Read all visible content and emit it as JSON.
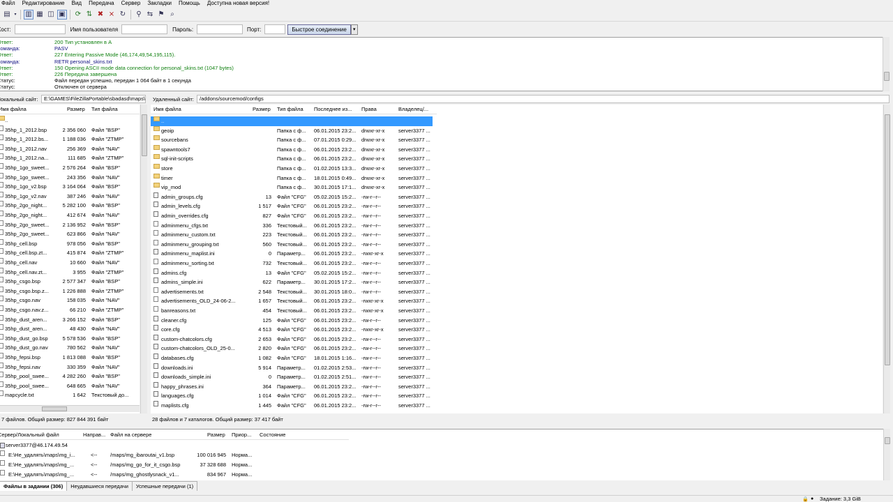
{
  "menu": [
    "Файл",
    "Редактирование",
    "Вид",
    "Передача",
    "Сервер",
    "Закладки",
    "Помощь",
    "Доступна новая версия!"
  ],
  "quickconnect": {
    "host_label": "Хост:",
    "user_label": "Имя пользователя",
    "pass_label": "Пароль:",
    "port_label": "Порт:",
    "button": "Быстрое соединение",
    "host": "",
    "user": "",
    "password": "",
    "port": ""
  },
  "log": [
    {
      "k": "Ответ:",
      "v": "200 Тип установлен в A",
      "c": "#108010"
    },
    {
      "k": "Команда:",
      "v": "PASV",
      "c": "#101080"
    },
    {
      "k": "Ответ:",
      "v": "227 Entering Passive Mode (46,174,49,54,195,115).",
      "c": "#108010"
    },
    {
      "k": "Команда:",
      "v": "RETR personal_skins.txt",
      "c": "#101080"
    },
    {
      "k": "Ответ:",
      "v": "150 Opening ASCII mode data connection for personal_skins.txt (1047 bytes)",
      "c": "#108010"
    },
    {
      "k": "Ответ:",
      "v": "226 Передача завершена",
      "c": "#108010"
    },
    {
      "k": "Статус:",
      "v": "Файл передан успешно, передан 1 064 байт в 1 секунда",
      "c": "#000000"
    },
    {
      "k": "Статус:",
      "v": "Отключен от сервера",
      "c": "#000000"
    }
  ],
  "local": {
    "site_label": "Локальный сайт:",
    "path": "E:\\GAMES\\FileZillaPortable\\sbadasd\\maps\\",
    "headers": {
      "name": "Имя файла",
      "size": "Размер",
      "type": "Тип файла"
    },
    "files": [
      {
        "name": "..",
        "size": "",
        "type": "",
        "dir": true
      },
      {
        "name": "35hp_1_2012.bsp",
        "size": "2 356 060",
        "type": "Файл \"BSP\""
      },
      {
        "name": "35hp_1_2012.bs...",
        "size": "1 188 036",
        "type": "Файл \"ZTMP\""
      },
      {
        "name": "35hp_1_2012.nav",
        "size": "256 369",
        "type": "Файл \"NAV\""
      },
      {
        "name": "35hp_1_2012.na...",
        "size": "111 685",
        "type": "Файл \"ZTMP\""
      },
      {
        "name": "35hp_1go_sweet...",
        "size": "2 576 264",
        "type": "Файл \"BSP\""
      },
      {
        "name": "35hp_1go_sweet...",
        "size": "243 356",
        "type": "Файл \"NAV\""
      },
      {
        "name": "35hp_1go_v2.bsp",
        "size": "3 164 064",
        "type": "Файл \"BSP\""
      },
      {
        "name": "35hp_1go_v2.nav",
        "size": "387 246",
        "type": "Файл \"NAV\""
      },
      {
        "name": "35hp_2go_night...",
        "size": "5 282 100",
        "type": "Файл \"BSP\""
      },
      {
        "name": "35hp_2go_night...",
        "size": "412 674",
        "type": "Файл \"NAV\""
      },
      {
        "name": "35hp_2go_sweet...",
        "size": "2 136 952",
        "type": "Файл \"BSP\""
      },
      {
        "name": "35hp_2go_sweet...",
        "size": "623 866",
        "type": "Файл \"NAV\""
      },
      {
        "name": "35hp_cell.bsp",
        "size": "978 056",
        "type": "Файл \"BSP\""
      },
      {
        "name": "35hp_cell.bsp.zt...",
        "size": "415 874",
        "type": "Файл \"ZTMP\""
      },
      {
        "name": "35hp_cell.nav",
        "size": "10 660",
        "type": "Файл \"NAV\""
      },
      {
        "name": "35hp_cell.nav.zt...",
        "size": "3 955",
        "type": "Файл \"ZTMP\""
      },
      {
        "name": "35hp_csgo.bsp",
        "size": "2 577 347",
        "type": "Файл \"BSP\""
      },
      {
        "name": "35hp_csgo.bsp.z...",
        "size": "1 226 888",
        "type": "Файл \"ZTMP\""
      },
      {
        "name": "35hp_csgo.nav",
        "size": "158 035",
        "type": "Файл \"NAV\""
      },
      {
        "name": "35hp_csgo.nav.z...",
        "size": "66 210",
        "type": "Файл \"ZTMP\""
      },
      {
        "name": "35hp_dust_aren...",
        "size": "3 266 152",
        "type": "Файл \"BSP\""
      },
      {
        "name": "35hp_dust_aren...",
        "size": "48 430",
        "type": "Файл \"NAV\""
      },
      {
        "name": "35hp_dust_go.bsp",
        "size": "5 578 536",
        "type": "Файл \"BSP\""
      },
      {
        "name": "35hp_dust_go.nav",
        "size": "780 562",
        "type": "Файл \"NAV\""
      },
      {
        "name": "35hp_fepsi.bsp",
        "size": "1 813 088",
        "type": "Файл \"BSP\""
      },
      {
        "name": "35hp_fepsi.nav",
        "size": "330 359",
        "type": "Файл \"NAV\""
      },
      {
        "name": "35hp_pool_swee...",
        "size": "4 282 260",
        "type": "Файл \"BSP\""
      },
      {
        "name": "35hp_pool_swee...",
        "size": "648 665",
        "type": "Файл \"NAV\""
      },
      {
        "name": "mapcycle.txt",
        "size": "1 642",
        "type": "Текстовый до..."
      }
    ],
    "status": "7 файлов. Общий размер: 827 844 391 байт"
  },
  "remote": {
    "site_label": "Удаленный сайт:",
    "path": "/addons/sourcemod/configs",
    "headers": {
      "name": "Имя файла",
      "size": "Размер",
      "type": "Тип файла",
      "modified": "Последнее из...",
      "perms": "Права",
      "owner": "Владелец/..."
    },
    "files": [
      {
        "name": "..",
        "size": "",
        "type": "",
        "modified": "",
        "perms": "",
        "owner": "",
        "kind": "dir",
        "selected": true
      },
      {
        "name": "geoip",
        "size": "",
        "type": "Папка с ф...",
        "modified": "06.01.2015 23:2...",
        "perms": "drwxr-xr-x",
        "owner": "server3377 ...",
        "kind": "dir"
      },
      {
        "name": "sourcebans",
        "size": "",
        "type": "Папка с ф...",
        "modified": "07.01.2015 0:29...",
        "perms": "drwxr-xr-x",
        "owner": "server3377 ...",
        "kind": "dir"
      },
      {
        "name": "spawntools7",
        "size": "",
        "type": "Папка с ф...",
        "modified": "06.01.2015 23:2...",
        "perms": "drwxr-xr-x",
        "owner": "server3377 ...",
        "kind": "dir"
      },
      {
        "name": "sql-init-scripts",
        "size": "",
        "type": "Папка с ф...",
        "modified": "06.01.2015 23:2...",
        "perms": "drwxr-xr-x",
        "owner": "server3377 ...",
        "kind": "dir"
      },
      {
        "name": "store",
        "size": "",
        "type": "Папка с ф...",
        "modified": "01.02.2015 13:3...",
        "perms": "drwxr-xr-x",
        "owner": "server3377 ...",
        "kind": "dir"
      },
      {
        "name": "timer",
        "size": "",
        "type": "Папка с ф...",
        "modified": "18.01.2015 0:49...",
        "perms": "drwxr-xr-x",
        "owner": "server3377 ...",
        "kind": "dir"
      },
      {
        "name": "vip_mod",
        "size": "",
        "type": "Папка с ф...",
        "modified": "30.01.2015 17:1...",
        "perms": "drwxr-xr-x",
        "owner": "server3377 ...",
        "kind": "dir"
      },
      {
        "name": "admin_groups.cfg",
        "size": "13",
        "type": "Файл \"CFG\"",
        "modified": "05.02.2015 15:2...",
        "perms": "-rw-r--r--",
        "owner": "server3377 ...",
        "kind": "cfg"
      },
      {
        "name": "admin_levels.cfg",
        "size": "1 517",
        "type": "Файл \"CFG\"",
        "modified": "06.01.2015 23:2...",
        "perms": "-rw-r--r--",
        "owner": "server3377 ...",
        "kind": "cfg"
      },
      {
        "name": "admin_overrides.cfg",
        "size": "827",
        "type": "Файл \"CFG\"",
        "modified": "06.01.2015 23:2...",
        "perms": "-rw-r--r--",
        "owner": "server3377 ...",
        "kind": "cfg"
      },
      {
        "name": "adminmenu_cfgs.txt",
        "size": "336",
        "type": "Текстовый...",
        "modified": "06.01.2015 23:2...",
        "perms": "-rw-r--r--",
        "owner": "server3377 ...",
        "kind": "file"
      },
      {
        "name": "adminmenu_custom.txt",
        "size": "223",
        "type": "Текстовый...",
        "modified": "06.01.2015 23:2...",
        "perms": "-rw-r--r--",
        "owner": "server3377 ...",
        "kind": "file"
      },
      {
        "name": "adminmenu_grouping.txt",
        "size": "560",
        "type": "Текстовый...",
        "modified": "06.01.2015 23:2...",
        "perms": "-rw-r--r--",
        "owner": "server3377 ...",
        "kind": "file"
      },
      {
        "name": "adminmenu_maplist.ini",
        "size": "0",
        "type": "Параметр...",
        "modified": "06.01.2015 23:2...",
        "perms": "-rwxr-xr-x",
        "owner": "server3377 ...",
        "kind": "cfg"
      },
      {
        "name": "adminmenu_sorting.txt",
        "size": "732",
        "type": "Текстовый...",
        "modified": "06.01.2015 23:2...",
        "perms": "-rw-r--r--",
        "owner": "server3377 ...",
        "kind": "file"
      },
      {
        "name": "admins.cfg",
        "size": "13",
        "type": "Файл \"CFG\"",
        "modified": "05.02.2015 15:2...",
        "perms": "-rw-r--r--",
        "owner": "server3377 ...",
        "kind": "cfg"
      },
      {
        "name": "admins_simple.ini",
        "size": "622",
        "type": "Параметр...",
        "modified": "30.01.2015 17:2...",
        "perms": "-rw-r--r--",
        "owner": "server3377 ...",
        "kind": "cfg"
      },
      {
        "name": "advertisements.txt",
        "size": "2 548",
        "type": "Текстовый...",
        "modified": "30.01.2015 18:0...",
        "perms": "-rw-r--r--",
        "owner": "server3377 ...",
        "kind": "file"
      },
      {
        "name": "advertisements_OLD_24-06-2...",
        "size": "1 657",
        "type": "Текстовый...",
        "modified": "06.01.2015 23:2...",
        "perms": "-rwxr-xr-x",
        "owner": "server3377 ...",
        "kind": "file"
      },
      {
        "name": "banreasons.txt",
        "size": "454",
        "type": "Текстовый...",
        "modified": "06.01.2015 23:2...",
        "perms": "-rwxr-xr-x",
        "owner": "server3377 ...",
        "kind": "file"
      },
      {
        "name": "cleaner.cfg",
        "size": "125",
        "type": "Файл \"CFG\"",
        "modified": "06.01.2015 23:2...",
        "perms": "-rw-r--r--",
        "owner": "server3377 ...",
        "kind": "cfg"
      },
      {
        "name": "core.cfg",
        "size": "4 513",
        "type": "Файл \"CFG\"",
        "modified": "06.01.2015 23:2...",
        "perms": "-rwxr-xr-x",
        "owner": "server3377 ...",
        "kind": "cfg"
      },
      {
        "name": "custom-chatcolors.cfg",
        "size": "2 653",
        "type": "Файл \"CFG\"",
        "modified": "06.01.2015 23:2...",
        "perms": "-rw-r--r--",
        "owner": "server3377 ...",
        "kind": "cfg"
      },
      {
        "name": "custom-chatcolors_OLD_25-0...",
        "size": "2 820",
        "type": "Файл \"CFG\"",
        "modified": "06.01.2015 23:2...",
        "perms": "-rw-r--r--",
        "owner": "server3377 ...",
        "kind": "cfg"
      },
      {
        "name": "databases.cfg",
        "size": "1 082",
        "type": "Файл \"CFG\"",
        "modified": "18.01.2015 1:16...",
        "perms": "-rw-r--r--",
        "owner": "server3377 ...",
        "kind": "cfg"
      },
      {
        "name": "downloads.ini",
        "size": "5 914",
        "type": "Параметр...",
        "modified": "01.02.2015 2:53...",
        "perms": "-rw-r--r--",
        "owner": "server3377 ...",
        "kind": "cfg"
      },
      {
        "name": "downloads_simple.ini",
        "size": "0",
        "type": "Параметр...",
        "modified": "01.02.2015 2:51...",
        "perms": "-rw-r--r--",
        "owner": "server3377 ...",
        "kind": "cfg"
      },
      {
        "name": "happy_phrases.ini",
        "size": "364",
        "type": "Параметр...",
        "modified": "06.01.2015 23:2...",
        "perms": "-rw-r--r--",
        "owner": "server3377 ...",
        "kind": "cfg"
      },
      {
        "name": "languages.cfg",
        "size": "1 014",
        "type": "Файл \"CFG\"",
        "modified": "06.01.2015 23:2...",
        "perms": "-rw-r--r--",
        "owner": "server3377 ...",
        "kind": "cfg"
      },
      {
        "name": "maplists.cfg",
        "size": "1 445",
        "type": "Файл \"CFG\"",
        "modified": "06.01.2015 23:2...",
        "perms": "-rw-r--r--",
        "owner": "server3377 ...",
        "kind": "cfg"
      }
    ],
    "status": "28 файлов и 7 каталогов. Общий размер: 37 417 байт"
  },
  "queue": {
    "headers": {
      "server": "Сервер/Локальный файл",
      "dir": "Направ...",
      "remote": "Файл на сервере",
      "size": "Размер",
      "prio": "Приор...",
      "status": "Состояние"
    },
    "server": "server3377@46.174.49.54",
    "items": [
      {
        "local": "E:\\Не_удалять\\maps\\mg_i...",
        "dir": "<--",
        "remote": "/maps/mg_ibaroutai_v1.bsp",
        "size": "100 016 945",
        "prio": "Норма..."
      },
      {
        "local": "E:\\Не_удалять\\maps\\mg_...",
        "dir": "<--",
        "remote": "/maps/mg_go_for_it_csgo.bsp",
        "size": "37 328 688",
        "prio": "Норма..."
      },
      {
        "local": "E:\\Не_удалять\\maps\\mg_...",
        "dir": "<--",
        "remote": "/maps/mg_ghostlysnack_v1...",
        "size": "834 967",
        "prio": "Норма..."
      }
    ],
    "tabs": [
      "Файлы в задании (306)",
      "Неудавшиеся передачи",
      "Успешные передачи (1)"
    ]
  },
  "statusbar": {
    "queue": "Задание: 3,3 GiB"
  },
  "colors": {
    "selection": "#3399ff",
    "log_response": "#108010",
    "log_command": "#101080"
  }
}
